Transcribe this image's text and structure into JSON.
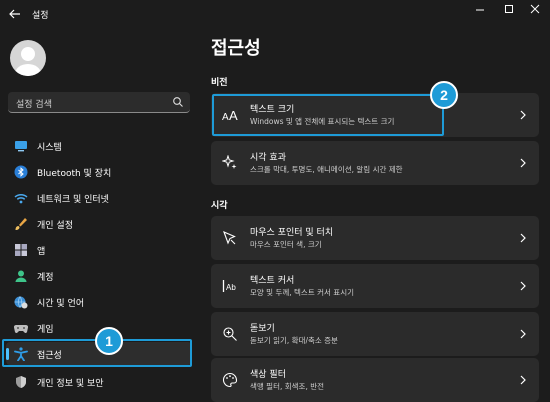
{
  "titlebar": {
    "app_title": "설정"
  },
  "search": {
    "placeholder": "설정 검색"
  },
  "sidebar": {
    "items": [
      {
        "label": "시스템",
        "icon": "monitor-icon"
      },
      {
        "label": "Bluetooth 및 장치",
        "icon": "bluetooth-icon"
      },
      {
        "label": "네트워크 및 인터넷",
        "icon": "wifi-icon"
      },
      {
        "label": "개인 설정",
        "icon": "brush-icon"
      },
      {
        "label": "앱",
        "icon": "apps-icon"
      },
      {
        "label": "계정",
        "icon": "account-icon"
      },
      {
        "label": "시간 및 언어",
        "icon": "globe-clock-icon"
      },
      {
        "label": "게임",
        "icon": "gamepad-icon"
      },
      {
        "label": "접근성",
        "icon": "accessibility-icon",
        "active": true
      },
      {
        "label": "개인 정보 및 보안",
        "icon": "shield-icon"
      }
    ]
  },
  "main": {
    "title": "접근성",
    "sections": [
      {
        "title": "비전",
        "cards": [
          {
            "title": "텍스트 크기",
            "desc": "Windows 및 앱 전체에 표시되는 텍스트 크기",
            "icon": "text-size-icon"
          },
          {
            "title": "시각 효과",
            "desc": "스크롤 막대, 투명도, 애니메이션, 알림 시간 제한",
            "icon": "sparkle-icon"
          }
        ]
      },
      {
        "title": "시각",
        "cards": [
          {
            "title": "마우스 포인터 및 터치",
            "desc": "마우스 포인터 색, 크기",
            "icon": "mouse-pointer-icon"
          },
          {
            "title": "텍스트 커서",
            "desc": "모양 및 두께, 텍스트 커서 표시기",
            "icon": "text-cursor-icon"
          },
          {
            "title": "돋보기",
            "desc": "돋보기 읽기, 확대/축소 증분",
            "icon": "magnifier-icon"
          },
          {
            "title": "색상 필터",
            "desc": "색맹 필터, 회색조, 반전",
            "icon": "color-filter-icon"
          }
        ]
      }
    ]
  },
  "annotations": {
    "badge_1": "1",
    "badge_2": "2",
    "accent": "#1e9bd7"
  }
}
